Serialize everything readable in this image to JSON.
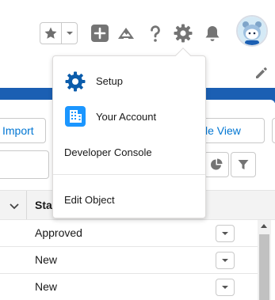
{
  "header": {
    "icons": [
      "star-icon",
      "chevron-down-icon",
      "add-icon",
      "trailhead-icon",
      "help-icon",
      "gear-icon",
      "bell-icon",
      "avatar"
    ]
  },
  "toolbar": {
    "import_label": "Import",
    "view_label": "le View"
  },
  "table": {
    "status_header": "Stat",
    "rows": [
      {
        "status": "Approved"
      },
      {
        "status": "New"
      },
      {
        "status": "New"
      }
    ]
  },
  "setup_menu": {
    "items": [
      {
        "label": "Setup",
        "icon": "gear-icon"
      },
      {
        "label": "Your Account",
        "icon": "building-icon"
      },
      {
        "label": "Developer Console"
      },
      {
        "label": "Edit Object"
      }
    ]
  },
  "colors": {
    "brand_blue": "#1b5fb3",
    "link_blue": "#0176d3",
    "icon_gray": "#747474"
  }
}
